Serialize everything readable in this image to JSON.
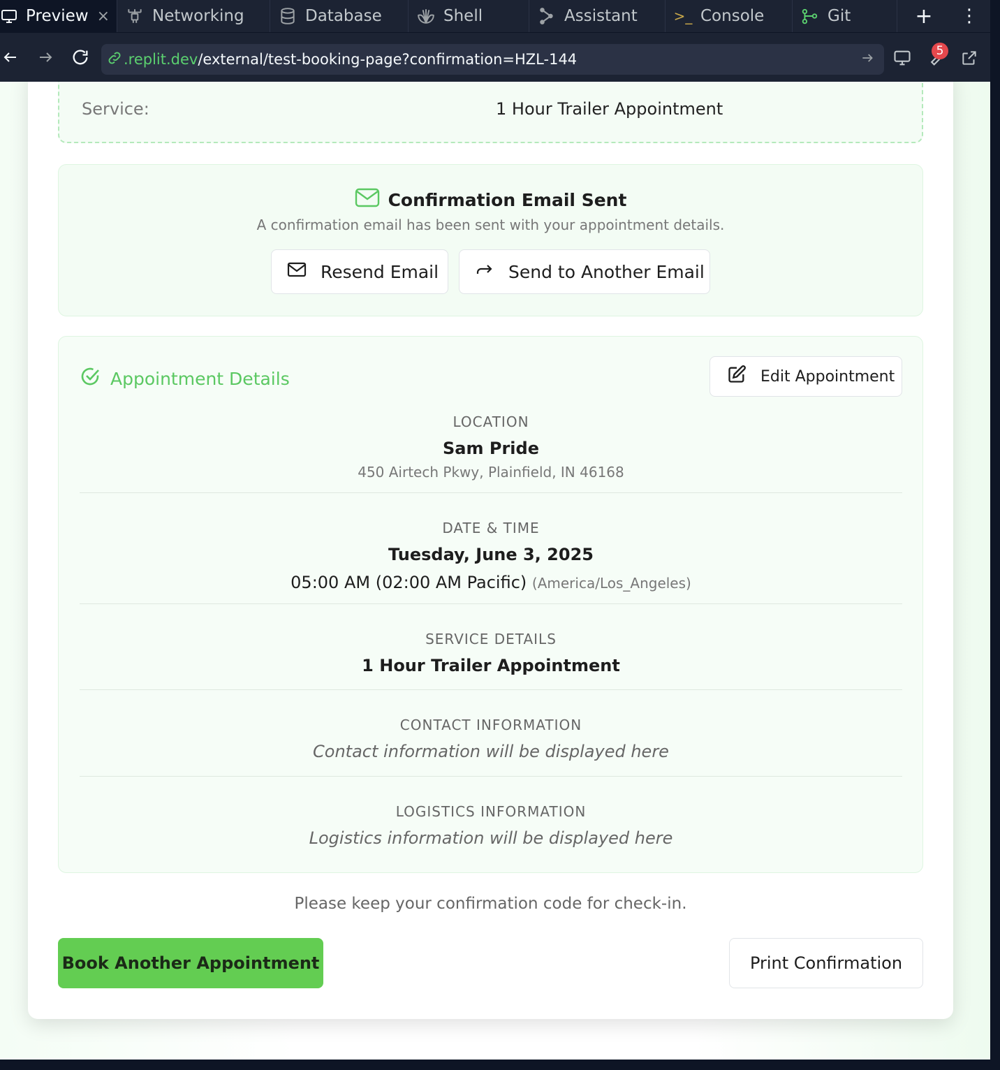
{
  "tabs": [
    {
      "label": "Preview",
      "icon": "monitor-icon",
      "active": true
    },
    {
      "label": "Networking",
      "icon": "network-icon"
    },
    {
      "label": "Database",
      "icon": "database-icon"
    },
    {
      "label": "Shell",
      "icon": "shell-icon"
    },
    {
      "label": "Assistant",
      "icon": "assistant-icon"
    },
    {
      "label": "Console",
      "icon": "console-icon"
    },
    {
      "label": "Git",
      "icon": "git-icon"
    }
  ],
  "address": {
    "domain": ".replit.dev",
    "path": "/external/test-booking-page?confirmation=HZL-144",
    "badge_count": "5"
  },
  "service": {
    "label": "Service:",
    "value": "1 Hour Trailer Appointment"
  },
  "email": {
    "title": "Confirmation Email Sent",
    "subtitle": "A confirmation email has been sent with your appointment details.",
    "resend_label": "Resend Email",
    "send_another_label": "Send to Another Email"
  },
  "details": {
    "heading": "Appointment Details",
    "edit_label": "Edit Appointment",
    "location": {
      "label": "LOCATION",
      "name": "Sam Pride",
      "address": "450 Airtech Pkwy, Plainfield, IN 46168"
    },
    "datetime": {
      "label": "DATE & TIME",
      "date": "Tuesday, June 3, 2025",
      "time": "05:00 AM (02:00 AM Pacific)",
      "timezone": "(America/Los_Angeles)"
    },
    "service": {
      "label": "SERVICE DETAILS",
      "value": "1 Hour Trailer Appointment"
    },
    "contact": {
      "label": "CONTACT INFORMATION",
      "value": "Contact information will be displayed here"
    },
    "logistics": {
      "label": "LOGISTICS INFORMATION",
      "value": "Logistics information will be displayed here"
    }
  },
  "footer": {
    "note": "Please keep your confirmation code for check-in.",
    "book_label": "Book Another Appointment",
    "print_label": "Print Confirmation"
  },
  "colors": {
    "accent_green": "#63cd52",
    "heading_green": "#5bc862",
    "ide_dark": "#1c2333"
  }
}
